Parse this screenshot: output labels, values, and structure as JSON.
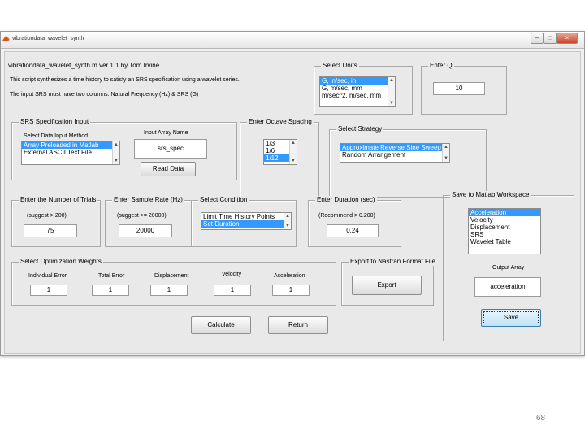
{
  "window": {
    "title": "vibrationdata_wavelet_synth",
    "controls": {
      "minimize": "–",
      "maximize": "□",
      "close": "×"
    }
  },
  "header": {
    "line1": "vibrationdata_wavelet_synth.m ver 1.1 by Tom Irvine",
    "line2": "This script synthesizes a time history to satisfy an SRS specification using a wavelet series.",
    "line3": "The input SRS must have two columns: Natural Frequency (Hz) & SRS (G)"
  },
  "select_units": {
    "title": "Select Units",
    "options": [
      "G, in/sec, in",
      "G, m/sec, mm",
      "m/sec^2, m/sec, mm"
    ],
    "selected_index": 0
  },
  "enter_q": {
    "title": "Enter Q",
    "value": "10"
  },
  "srs_spec": {
    "title": "SRS Specification Input",
    "method_label": "Select Data Input Method",
    "method_options": [
      "Array Preloaded in Matlab",
      "External ASCII Text File"
    ],
    "method_selected_index": 0,
    "array_label": "Input Array Name",
    "array_value": "srs_spec",
    "read_button": "Read Data"
  },
  "octave": {
    "title": "Enter Octave Spacing",
    "options": [
      "1/3",
      "1/6",
      "1/12"
    ],
    "selected_index": 2
  },
  "strategy": {
    "title": "Select Strategy",
    "options": [
      "Approximate Reverse Sine Sweep",
      "Random Arrangement"
    ],
    "selected_index": 0
  },
  "trials": {
    "title": "Enter the Number of Trials",
    "hint": "(suggest > 200)",
    "value": "75"
  },
  "sample_rate": {
    "title": "Enter Sample Rate (Hz)",
    "hint": "(suggest >= 20000)",
    "value": "20000"
  },
  "condition": {
    "title": "Select Condition",
    "options": [
      "Limit Time History Points",
      "Set Duration"
    ],
    "selected_index": 1
  },
  "duration": {
    "title": "Enter Duration (sec)",
    "hint": "(Recommend > 0.200)",
    "value": "0.24"
  },
  "workspace": {
    "title": "Save to Matlab Workspace",
    "options": [
      "Acceleration",
      "Velocity",
      "Displacement",
      "SRS",
      "Wavelet Table"
    ],
    "selected_index": 0,
    "output_label": "Output Array",
    "output_value": "acceleration",
    "save_button": "Save"
  },
  "weights": {
    "title": "Select Optimization Weights",
    "fields": [
      {
        "label": "Individual Error",
        "value": "1"
      },
      {
        "label": "Total Error",
        "value": "1"
      },
      {
        "label": "Displacement",
        "value": "1"
      },
      {
        "label": "Velocity",
        "value": "1"
      },
      {
        "label": "Acceleration",
        "value": "1"
      }
    ]
  },
  "export": {
    "title": "Export to Nastran Format File",
    "button": "Export"
  },
  "actions": {
    "calculate": "Calculate",
    "return": "Return"
  },
  "page_number": "68",
  "colors": {
    "selection": "#3399ff",
    "panel_bg": "#e9e9e9",
    "window_bg": "#f0f0f0"
  }
}
